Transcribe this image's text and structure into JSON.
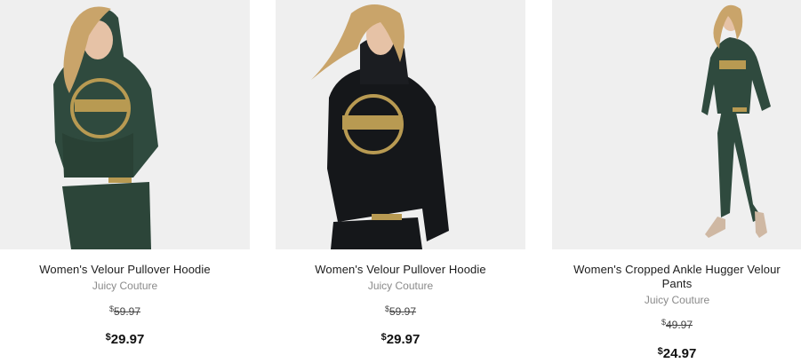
{
  "colors": {
    "background": "#ffffff",
    "image_bg": "#efefef",
    "velour_green": "#2f4a3e",
    "velour_black": "#15171a",
    "gold_print": "#b89a52",
    "hair": "#c9a46a",
    "skin": "#e6c2a6"
  },
  "products": [
    {
      "image_alt": "Women's Velour Pullover Hoodie green",
      "name": "Women's Velour Pullover Hoodie",
      "brand": "Juicy Couture",
      "currency": "$",
      "was_price": "59.97",
      "price": "29.97"
    },
    {
      "image_alt": "Women's Velour Pullover Hoodie black",
      "name": "Women's Velour Pullover Hoodie",
      "brand": "Juicy Couture",
      "currency": "$",
      "was_price": "59.97",
      "price": "29.97"
    },
    {
      "image_alt": "Women's Cropped Ankle Hugger Velour Pants",
      "name": "Women's Cropped Ankle Hugger Velour Pants",
      "brand": "Juicy Couture",
      "currency": "$",
      "was_price": "49.97",
      "price": "24.97"
    }
  ]
}
